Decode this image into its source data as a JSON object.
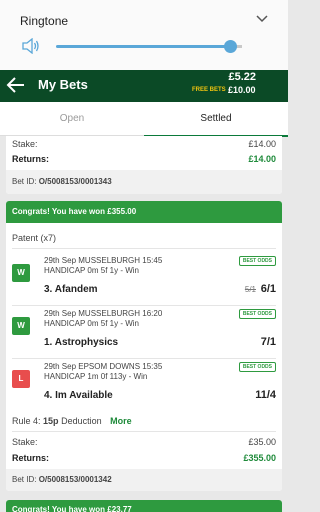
{
  "ringtone": {
    "title": "Ringtone",
    "volume": 0.94
  },
  "header": {
    "title": "My Bets",
    "balance": "£5.22",
    "free_bets_label": "FREE BETS",
    "free_bets_value": "£10.00"
  },
  "tabs": [
    {
      "label": "Open"
    },
    {
      "label": "Settled"
    }
  ],
  "bet1": {
    "stake_label": "Stake:",
    "stake_value": "£14.00",
    "returns_label": "Returns:",
    "returns_value": "£14.00",
    "bet_id_label": "Bet ID:",
    "bet_id_value": "O/5008153/0001343"
  },
  "bet2": {
    "banner": "Congrats! You have won £355.00",
    "type": "Patent (x7)",
    "selections": [
      {
        "result": "W",
        "line1": "29th Sep MUSSELBURGH 15:45",
        "line2": "HANDICAP 0m 5f 1y - Win",
        "name": "3. Afandem",
        "was": "5/1",
        "odds": "6/1",
        "badge": "BEST ODDS"
      },
      {
        "result": "W",
        "line1": "29th Sep MUSSELBURGH 16:20",
        "line2": "HANDICAP 0m 5f 1y - Win",
        "name": "1. Astrophysics",
        "was": "",
        "odds": "7/1",
        "badge": "BEST ODDS"
      },
      {
        "result": "L",
        "line1": "29th Sep EPSOM DOWNS 15:35",
        "line2": "HANDICAP 1m 0f 113y - Win",
        "name": "4. Im Available",
        "was": "",
        "odds": "11/4",
        "badge": "BEST ODDS"
      }
    ],
    "rule4_label": "Rule 4:",
    "rule4_amount": "15p",
    "rule4_text": "Deduction",
    "more": "More",
    "stake_label": "Stake:",
    "stake_value": "£35.00",
    "returns_label": "Returns:",
    "returns_value": "£355.00",
    "bet_id_label": "Bet ID:",
    "bet_id_value": "O/5008153/0001342"
  },
  "bet3": {
    "banner": "Congrats! You have won £23.77"
  }
}
